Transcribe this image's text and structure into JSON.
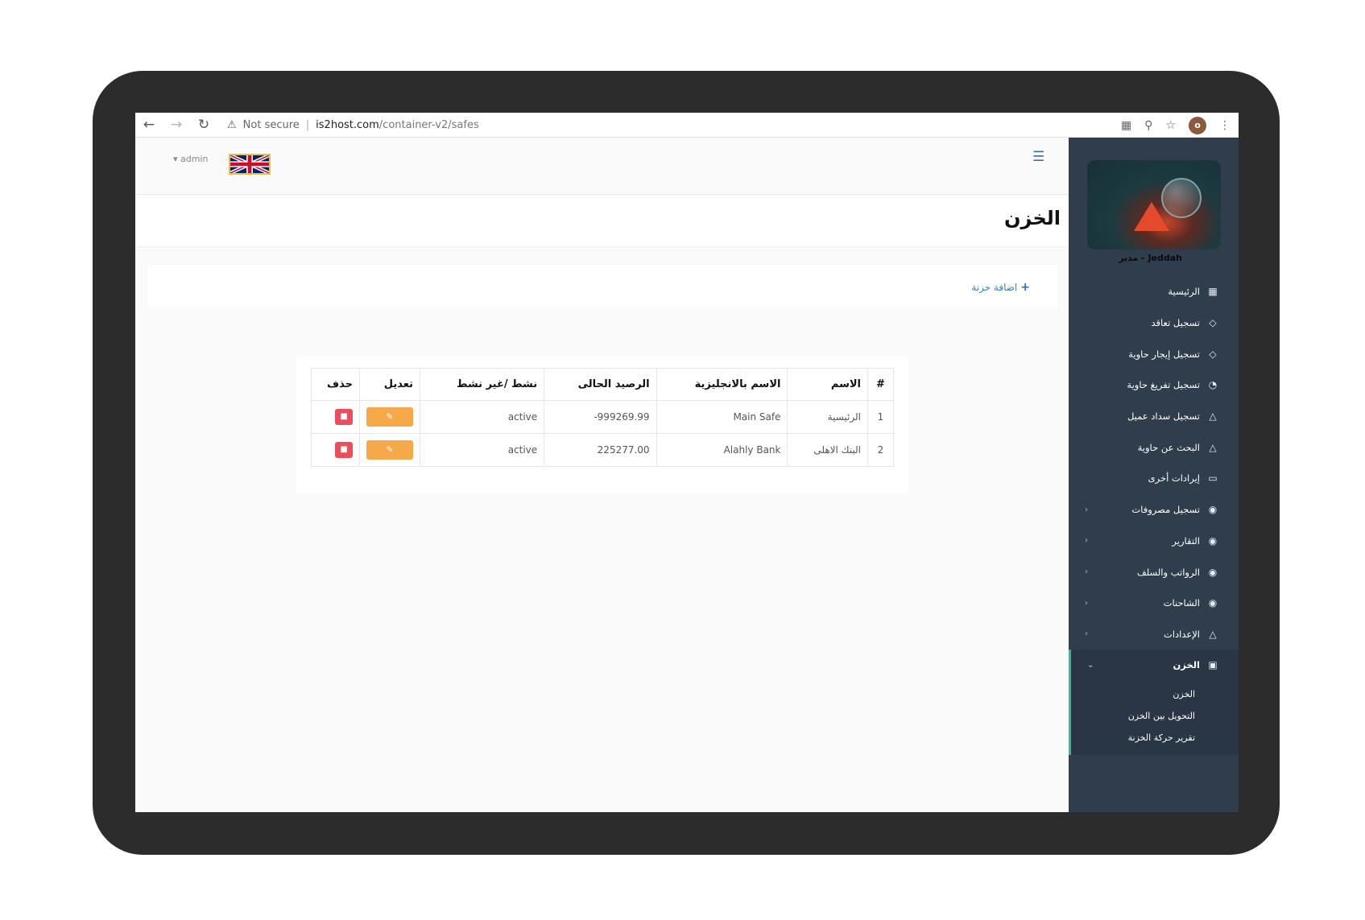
{
  "browser": {
    "warning": "Not secure",
    "url_host": "is2host.com",
    "url_path": "/container-v2/safes",
    "profile_initial": "o"
  },
  "header": {
    "user": "admin"
  },
  "page": {
    "title": "الخزن",
    "add_label": "اضافة خزنة"
  },
  "table": {
    "headers": [
      "#",
      "الاسم",
      "الاسم بالانجليزية",
      "الرصيد الحالى",
      "نشط /غير نشط",
      "تعديل",
      "حذف"
    ],
    "rows": [
      {
        "num": "1",
        "name": "الرئيسية",
        "name_en": "Main Safe",
        "balance": "-999269.99",
        "status": "active"
      },
      {
        "num": "2",
        "name": "البنك الاهلى",
        "name_en": "Alahly Bank",
        "balance": "225277.00",
        "status": "active"
      }
    ]
  },
  "sidebar": {
    "user_label": "Jeddah - مدير",
    "items": [
      {
        "label": "الرئيسية",
        "icon": "grid-icon"
      },
      {
        "label": "تسجيل تعاقد",
        "icon": "diamond-icon"
      },
      {
        "label": "تسجيل إيجار حاوية",
        "icon": "diamond-icon"
      },
      {
        "label": "تسجيل تفريغ حاوية",
        "icon": "pie-icon"
      },
      {
        "label": "تسجيل سداد عميل",
        "icon": "flask-icon"
      },
      {
        "label": "البحث عن حاوية",
        "icon": "flask-icon"
      },
      {
        "label": "إيرادات أخرى",
        "icon": "monitor-icon"
      },
      {
        "label": "تسجيل مصروفات",
        "icon": "globe-icon"
      },
      {
        "label": "التقارير",
        "icon": "globe-icon"
      },
      {
        "label": "الرواتب والسلف",
        "icon": "globe-icon"
      },
      {
        "label": "الشاحنات",
        "icon": "globe-icon"
      },
      {
        "label": "الإعدادات",
        "icon": "flask-icon"
      },
      {
        "label": "الخزن",
        "icon": "money-icon"
      }
    ],
    "sub_items": [
      "الخزن",
      "التحويل بين الخزن",
      "تقرير حركة الخزنة"
    ]
  }
}
